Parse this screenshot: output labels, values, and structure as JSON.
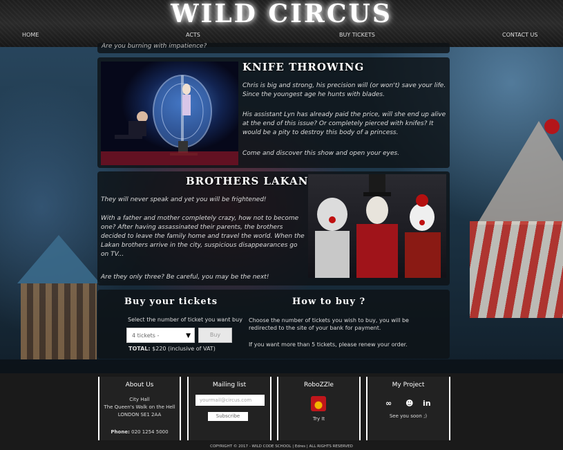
{
  "header": {
    "logo": "WILD CIRCUS",
    "nav": [
      "HOME",
      "ACTS",
      "BUY TICKETS",
      "CONTACT US"
    ]
  },
  "top_strip": "Are you burning with impatience?",
  "acts": [
    {
      "title": "KNIFE THROWING",
      "paragraphs": [
        "Chris is big and strong, his precision will (or won't) save your life. Since the youngest age he hunts with blades.",
        "His assistant Lyn has already paid the price, will she end up alive at the end of this issue? Or completely pierced with knifes? It would be a pity to destroy this body of a princess.",
        "Come and discover this show and open your eyes."
      ]
    },
    {
      "title": "BROTHERS LAKAN",
      "paragraphs": [
        "They will never speak and yet you will be frightened!",
        "With a father and mother completely crazy, how not to become one? After having assassinated their parents, the brothers decided to leave the family home and travel the world. When the Lakan brothers arrive in the city, suspicious disappearances go on TV...",
        "Are they only three? Be careful, you may be the next!"
      ]
    }
  ],
  "tickets": {
    "title": "Buy your tickets",
    "instruction": "Select the number of ticket you want buy",
    "select_value": "4 tickets -",
    "buy_label": "Buy",
    "total_label": "TOTAL:",
    "total_value": "$220 (inclusive of VAT)"
  },
  "how_to_buy": {
    "title": "How to buy ?",
    "text1": "Choose the number of tickets you wish to buy, you will be redirected to the site of your bank for payment.",
    "text2": "If you want more than 5 tickets, please renew your order."
  },
  "footer": {
    "about": {
      "title": "About Us",
      "line1": "City Hall",
      "line2": "The Queen's Walk on the Hell",
      "line3": "LONDON SE1 2AA",
      "phone_label": "Phone:",
      "phone": "020 1254 5000"
    },
    "mailing": {
      "title": "Mailing list",
      "placeholder": "yourmail@circus.com",
      "subscribe": "Subscribe"
    },
    "robozzle": {
      "title": "RoboZZle",
      "link": "Try It"
    },
    "project": {
      "title": "My Project",
      "text": "See you soon ;)"
    },
    "copyright": "COPYRIGHT © 2017 - WILD CODE SCHOOL | Edres | ALL RIGHTS RESERVED"
  },
  "colors": {
    "accent": "#ffffff",
    "panel": "#0e1216",
    "footer": "#1a1a1a"
  }
}
